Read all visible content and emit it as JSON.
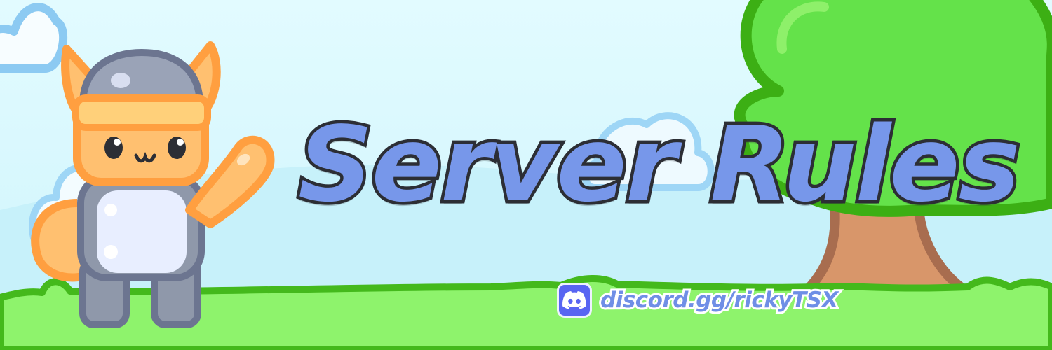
{
  "banner": {
    "title": "Server Rules",
    "invite_link": "discord.gg/rickyTSX"
  },
  "icons": {
    "discord": "discord-logo-icon"
  },
  "colors": {
    "sky": "#dcf8fd",
    "title_fill": "#7797ea",
    "title_outline": "#2c2e35",
    "grass": "#8ef36c",
    "grass_outline": "#44b91c",
    "tree_canopy": "#64e24a",
    "tree_trunk": "#d8966a",
    "mascot_fur": "#ffc070",
    "mascot_helmet": "#8f98aa",
    "discord_brand": "#5865f2"
  }
}
